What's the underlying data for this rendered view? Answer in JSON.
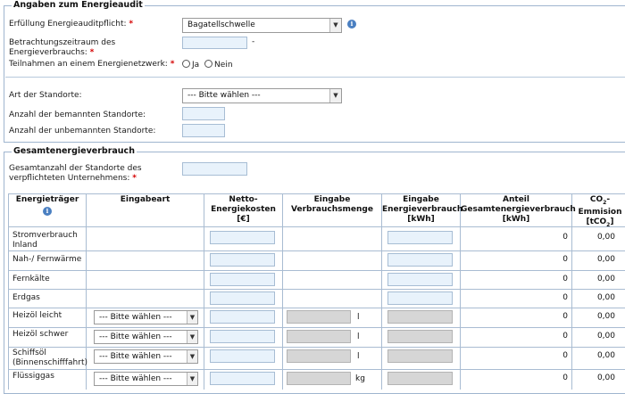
{
  "audit": {
    "legend": "Angaben zum Energieaudit",
    "pflicht_label": "Erfüllung Energieauditpflicht:",
    "pflicht_value": "Bagatellschwelle",
    "zeitraum_label_1": "Betrachtungszeitraum des",
    "zeitraum_label_2": "Energieverbrauchs:",
    "zeitraum_sep": "-",
    "netzwerk_label": "Teilnahmen an einem Energienetzwerk:",
    "option_ja": "Ja",
    "option_nein": "Nein",
    "standorte_label": "Art der Standorte:",
    "standorte_value": "--- Bitte wählen ---",
    "bemannt_label": "Anzahl der bemannten Standorte:",
    "unbemannt_label": "Anzahl der unbemannten Standorte:",
    "required_mark": "*"
  },
  "gesamt": {
    "legend": "Gesamtenergieverbrauch",
    "anzahl_label_1": "Gesamtanzahl der Standorte des",
    "anzahl_label_2": "verpflichteten Unternehmens:"
  },
  "table": {
    "headers": {
      "traeger": "Energieträger",
      "eingabeart": "Eingabeart",
      "kosten_1": "Netto-",
      "kosten_2": "Energiekosten",
      "kosten_3": "[€]",
      "menge_1": "Eingabe",
      "menge_2": "Verbrauchsmenge",
      "verbrauch_1": "Eingabe",
      "verbrauch_2": "Energieverbrauch",
      "verbrauch_3": "[kWh]",
      "anteil_1": "Anteil",
      "anteil_2": "Gesamtenergieverbrauch",
      "anteil_3": "[kWh]",
      "co2_1": "CO",
      "co2_sub": "2",
      "co2_2": "Emmision",
      "co2_3": "[tCO",
      "co2_3_sub": "2",
      "co2_3_end": "]"
    },
    "select_placeholder": "--- Bitte wählen ---",
    "rows": [
      {
        "name_1": "Stromverbrauch",
        "name_2": "Inland",
        "unit": "",
        "anteil": "0",
        "co2": "0,00"
      },
      {
        "name_1": "Nah-/ Fernwärme",
        "name_2": "",
        "unit": "",
        "anteil": "0",
        "co2": "0,00"
      },
      {
        "name_1": "Fernkälte",
        "name_2": "",
        "unit": "",
        "anteil": "0",
        "co2": "0,00"
      },
      {
        "name_1": "Erdgas",
        "name_2": "",
        "unit": "",
        "anteil": "0",
        "co2": "0,00"
      },
      {
        "name_1": "Heizöl leicht",
        "name_2": "",
        "unit": "l",
        "anteil": "0",
        "co2": "0,00"
      },
      {
        "name_1": "Heizöl schwer",
        "name_2": "",
        "unit": "l",
        "anteil": "0",
        "co2": "0,00"
      },
      {
        "name_1": "Schiffsöl",
        "name_2": "(Binnenschifffahrt)",
        "unit": "l",
        "anteil": "0",
        "co2": "0,00"
      },
      {
        "name_1": "Flüssiggas",
        "name_2": "",
        "unit": "kg",
        "anteil": "0",
        "co2": "0,00"
      }
    ]
  }
}
